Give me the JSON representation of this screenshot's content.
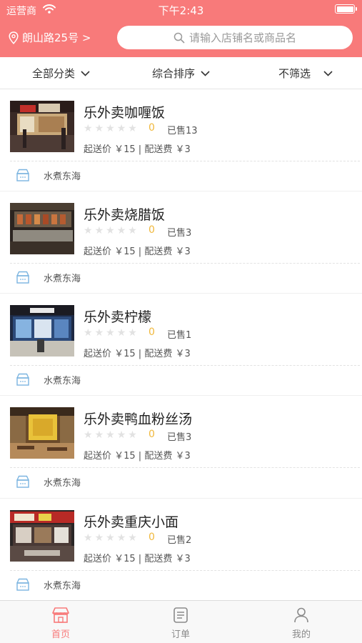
{
  "status_bar": {
    "carrier": "运营商",
    "time": "下午2:43"
  },
  "header": {
    "location": "朗山路25号 >",
    "search_placeholder": "请输入店铺名或商品名"
  },
  "filters": [
    "全部分类",
    "综合排序",
    "不筛选"
  ],
  "shops": [
    {
      "name": "乐外卖咖喱饭",
      "rating": "0",
      "rating_stars": 0,
      "sold": "已售13",
      "fees": "起送价 ￥15  |  配送费 ￥3",
      "tag": "水煮东海"
    },
    {
      "name": "乐外卖烧腊饭",
      "rating": "0",
      "rating_stars": 0,
      "sold": "已售3",
      "fees": "起送价 ￥15  |  配送费 ￥3",
      "tag": "水煮东海"
    },
    {
      "name": "乐外卖柠檬",
      "rating": "0",
      "rating_stars": 0,
      "sold": "已售1",
      "fees": "起送价 ￥15  |  配送费 ￥3",
      "tag": "水煮东海"
    },
    {
      "name": "乐外卖鸭血粉丝汤",
      "rating": "0",
      "rating_stars": 0,
      "sold": "已售3",
      "fees": "起送价 ￥15  |  配送费 ￥3",
      "tag": "水煮东海"
    },
    {
      "name": "乐外卖重庆小面",
      "rating": "0",
      "rating_stars": 0,
      "sold": "已售2",
      "fees": "起送价 ￥15  |  配送费 ￥3",
      "tag": "水煮东海"
    }
  ],
  "tabbar": {
    "home": {
      "label": "首页",
      "icon": "store-icon"
    },
    "orders": {
      "label": "订单",
      "icon": "order-list-icon"
    },
    "mine": {
      "label": "我的",
      "icon": "user-icon"
    }
  },
  "colors": {
    "brand": "#f87a7a",
    "rating": "#f0b83c",
    "tag_icon": "#7ab4e0"
  }
}
